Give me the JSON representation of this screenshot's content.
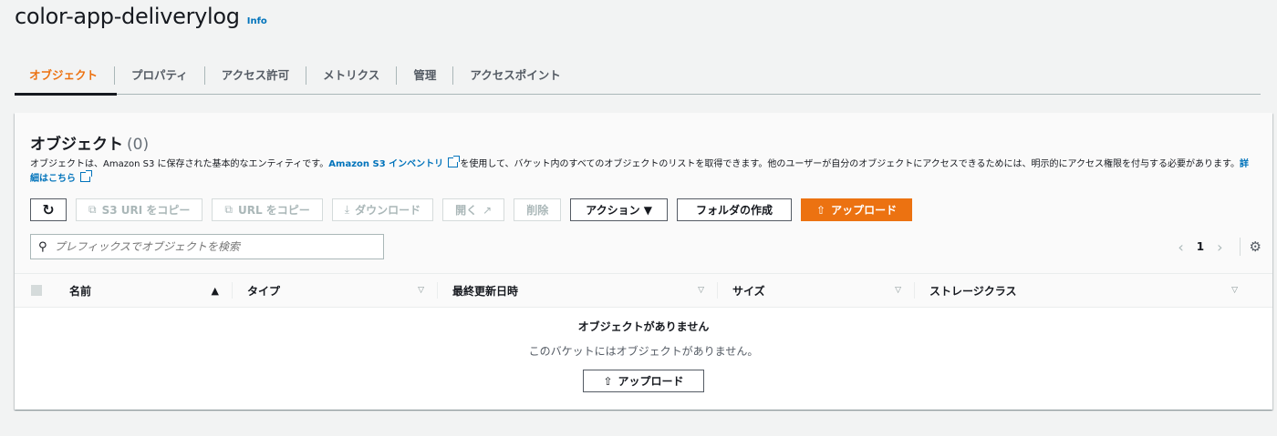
{
  "header": {
    "title": "color-app-deliverylog",
    "info": "Info"
  },
  "tabs": [
    "オブジェクト",
    "プロパティ",
    "アクセス許可",
    "メトリクス",
    "管理",
    "アクセスポイント"
  ],
  "panel": {
    "title": "オブジェクト",
    "count": "(0)",
    "desc_part1": "オブジェクトは、Amazon S3 に保存された基本的なエンティティです。",
    "desc_link": "Amazon S3 インベントリ",
    "desc_part2": "を使用して、バケット内のすべてのオブジェクトのリストを取得できます。他のユーザーが自分のオブジェクトにアクセスできるためには、明示的にアクセス権限を付与する必要があります。",
    "desc_more": "詳細はこちら"
  },
  "toolbar": {
    "copy_s3_uri": "S3 URI をコピー",
    "copy_url": "URL をコピー",
    "download": "ダウンロード",
    "open": "開く",
    "delete": "削除",
    "actions": "アクション ▼",
    "create_folder": "フォルダの作成",
    "upload": "アップロード"
  },
  "search": {
    "placeholder": "プレフィックスでオブジェクトを検索"
  },
  "pagination": {
    "page": "1"
  },
  "table": {
    "columns": [
      "名前",
      "タイプ",
      "最終更新日時",
      "サイズ",
      "ストレージクラス"
    ]
  },
  "empty": {
    "title": "オブジェクトがありません",
    "subtitle": "このバケットにはオブジェクトがありません。",
    "upload": "アップロード"
  },
  "colors": {
    "accent": "#ec7211",
    "link": "#0073bb"
  }
}
